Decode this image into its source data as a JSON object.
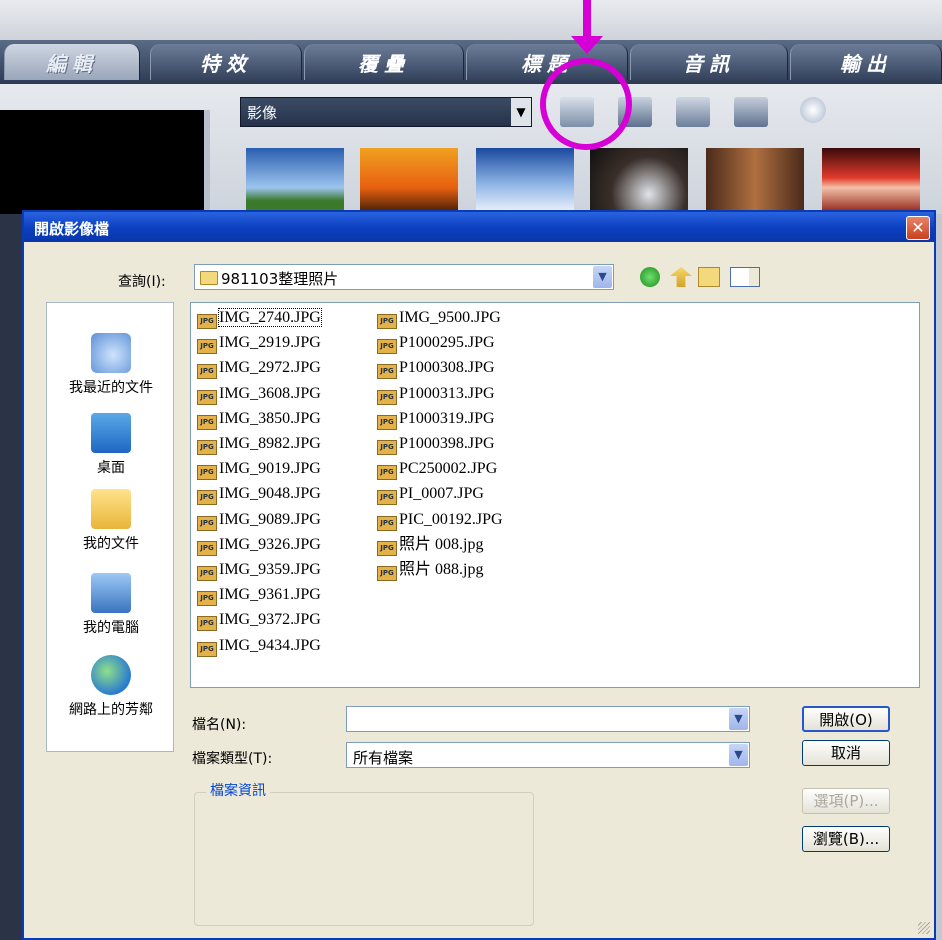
{
  "app": {
    "tabs": [
      {
        "label": "編輯",
        "active": true
      },
      {
        "label": "特效",
        "active": false
      },
      {
        "label": "覆疊",
        "active": false
      },
      {
        "label": "標題",
        "active": false
      },
      {
        "label": "音訊",
        "active": false
      },
      {
        "label": "輸出",
        "active": false
      }
    ],
    "library_select": "影像",
    "toolbar_icons": [
      "open-folder-icon",
      "import-icon",
      "view-options-icon",
      "sort-icon",
      "expand-icon"
    ]
  },
  "dialog": {
    "title": "開啟影像檔",
    "lookin_label": "查詢(I):",
    "lookin_value": "981103整理照片",
    "places": [
      {
        "label": "我最近的文件",
        "icon": "recent-documents-icon"
      },
      {
        "label": "桌面",
        "icon": "desktop-icon"
      },
      {
        "label": "我的文件",
        "icon": "my-documents-icon"
      },
      {
        "label": "我的電腦",
        "icon": "my-computer-icon"
      },
      {
        "label": "網路上的芳鄰",
        "icon": "network-places-icon"
      }
    ],
    "files_col1": [
      "IMG_2740.JPG",
      "IMG_2919.JPG",
      "IMG_2972.JPG",
      "IMG_3608.JPG",
      "IMG_3850.JPG",
      "IMG_8982.JPG",
      "IMG_9019.JPG",
      "IMG_9048.JPG",
      "IMG_9089.JPG",
      "IMG_9326.JPG",
      "IMG_9359.JPG",
      "IMG_9361.JPG",
      "IMG_9372.JPG",
      "IMG_9434.JPG"
    ],
    "files_col2": [
      "IMG_9500.JPG",
      "P1000295.JPG",
      "P1000308.JPG",
      "P1000313.JPG",
      "P1000319.JPG",
      "P1000398.JPG",
      "PC250002.JPG",
      "PI_0007.JPG",
      "PIC_00192.JPG",
      "照片 008.jpg",
      "照片 088.jpg"
    ],
    "file_icon_label": "JPG",
    "filename_label": "檔名(N):",
    "filename_value": "",
    "filetype_label": "檔案類型(T):",
    "filetype_value": "所有檔案",
    "buttons": {
      "open": "開啟(O)",
      "cancel": "取消",
      "options": "選項(P)...",
      "browse": "瀏覽(B)..."
    },
    "info_legend": "檔案資訊"
  },
  "colors": {
    "annotation": "#d600d6",
    "title_bar": "#0b3fc0",
    "dialog_bg": "#ece9d8"
  }
}
